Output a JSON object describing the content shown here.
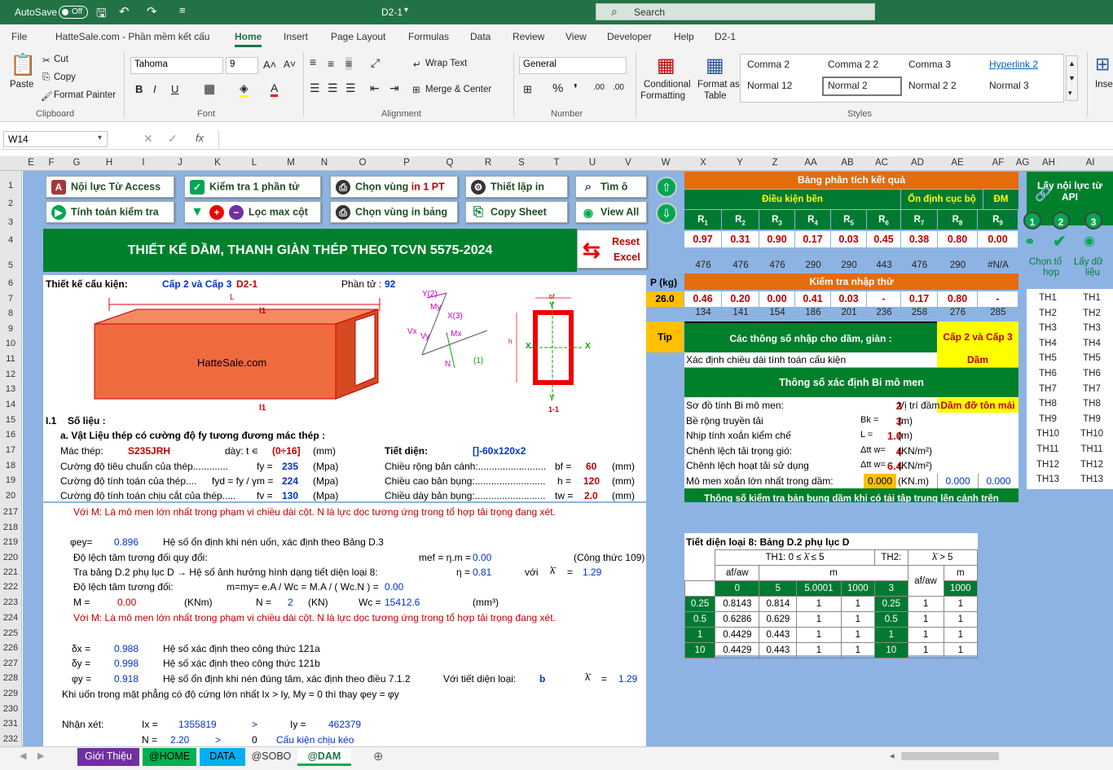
{
  "titlebar": {
    "autosave": "AutoSave",
    "toggle": "Off",
    "doc": "D2-1",
    "search": "Search"
  },
  "menu": [
    "File",
    "HatteSale.com - Phần mềm kết cấu",
    "Home",
    "Insert",
    "Page Layout",
    "Formulas",
    "Data",
    "Review",
    "View",
    "Developer",
    "Help",
    "D2-1"
  ],
  "ribbon": {
    "clipboard": {
      "paste": "Paste",
      "cut": "Cut",
      "copy": "Copy",
      "painter": "Format Painter",
      "label": "Clipboard"
    },
    "font": {
      "name": "Tahoma",
      "size": "9",
      "label": "Font"
    },
    "alignment": {
      "wrap": "Wrap Text",
      "merge": "Merge & Center",
      "label": "Alignment"
    },
    "number": {
      "format": "General",
      "label": "Number"
    },
    "styles": {
      "cond1": "Conditional",
      "cond2": "Formatting",
      "fmt1": "Format as",
      "fmt2": "Table",
      "cells": [
        "Comma 2",
        "Comma 2 2",
        "Comma 3",
        "Hyperlink 2",
        "Normal 12",
        "Normal 2",
        "Normal 2 2",
        "Normal 3"
      ],
      "label": "Styles"
    },
    "insert": "Inser"
  },
  "namebox": "W14",
  "columns": [
    [
      "E",
      38
    ],
    [
      "F",
      63
    ],
    [
      "G",
      94
    ],
    [
      "H",
      134
    ],
    [
      "I",
      176
    ],
    [
      "J",
      221
    ],
    [
      "K",
      267
    ],
    [
      "L",
      312
    ],
    [
      "M",
      357
    ],
    [
      "N",
      398
    ],
    [
      "O",
      445
    ],
    [
      "P",
      499
    ],
    [
      "Q",
      552
    ],
    [
      "R",
      599
    ],
    [
      "S",
      640
    ],
    [
      "T",
      683
    ],
    [
      "U",
      727
    ],
    [
      "V",
      771
    ],
    [
      "W",
      817
    ],
    [
      "X",
      863
    ],
    [
      "Y",
      908
    ],
    [
      "Z",
      951
    ],
    [
      "AA",
      995
    ],
    [
      "AB",
      1040
    ],
    [
      "AC",
      1082
    ],
    [
      "AD",
      1126
    ],
    [
      "AE",
      1175
    ],
    [
      "AF",
      1225
    ],
    [
      "AG",
      1255
    ],
    [
      "AH",
      1287
    ],
    [
      "AI",
      1338
    ]
  ],
  "rows": [
    [
      "1",
      228
    ],
    [
      "2",
      250
    ],
    [
      "3",
      273
    ],
    [
      "4",
      295
    ],
    [
      "5",
      326
    ],
    [
      "6",
      348
    ],
    [
      "7",
      367
    ],
    [
      "8",
      385
    ],
    [
      "9",
      404
    ],
    [
      "10",
      422
    ],
    [
      "11",
      441
    ],
    [
      "12",
      460
    ],
    [
      "13",
      478
    ],
    [
      "14",
      497
    ],
    [
      "15",
      516
    ],
    [
      "16",
      534
    ],
    [
      "17",
      553
    ],
    [
      "18",
      572
    ],
    [
      "19",
      590
    ],
    [
      "20",
      609
    ],
    [
      "217",
      629
    ],
    [
      "218",
      648
    ],
    [
      "219",
      666
    ],
    [
      "220",
      685
    ],
    [
      "221",
      703
    ],
    [
      "222",
      721
    ],
    [
      "223",
      740
    ],
    [
      "224",
      759
    ],
    [
      "225",
      778
    ],
    [
      "226",
      796
    ],
    [
      "227",
      815
    ],
    [
      "228",
      833
    ],
    [
      "229",
      852
    ],
    [
      "230",
      871
    ],
    [
      "231",
      889
    ],
    [
      "232",
      908
    ]
  ],
  "buttons": {
    "access": "Nội lực Từ Access",
    "check1": "Kiểm tra 1 phần tử",
    "sel1a": "Chọn vùng ",
    "sel1b": "in 1 PT",
    "setup": "Thiết lập in",
    "find": "Tìm ô",
    "calc": "Tính toán kiểm tra",
    "filter": "Lọc max cột",
    "selall": "Chọn vùng in bảng",
    "copysheet": "Copy Sheet",
    "viewall": "View All",
    "reset1": "Reset",
    "reset2": "Excel"
  },
  "title": "THIẾT KẾ DẦM, THANH GIÀN THÉP THEO TCVN 5575-2024",
  "design": {
    "label": "Thiết kế cấu kiện:",
    "grade": "Cấp 2 và Cấp 3",
    "code": "D2-1",
    "elem_label": "Phần tử :",
    "elem": "92",
    "L": "L",
    "l1": "l1",
    "l1b": "l1",
    "watermark": "HatteSale.com",
    "Y2": "Y(2)",
    "X3": "X(3)",
    "My": "My",
    "Mx": "Mx",
    "Vx": "Vx",
    "Vy": "Vy",
    "N": "N",
    "one": "(1)",
    "secX": "X",
    "secX2": "X",
    "secY": "Y",
    "secY2": "Y",
    "sec11": "1-1",
    "dimb": "bf",
    "dimh": "h"
  },
  "analysis": {
    "title": "Bảng phân tích kết quả",
    "bearing": "Điều kiện bền",
    "local": "Ổn định cục bộ",
    "dm": "ĐM",
    "R": [
      "R1",
      "R2",
      "R3",
      "R4",
      "R5",
      "R6",
      "R7",
      "R8",
      "R9"
    ],
    "vals": [
      "0.97",
      "0.31",
      "0.90",
      "0.17",
      "0.03",
      "0.45",
      "0.38",
      "0.80",
      "0.00"
    ],
    "row5": [
      "476",
      "476",
      "476",
      "290",
      "290",
      "443",
      "476",
      "290",
      "#N/A"
    ]
  },
  "pkg": {
    "label": "P (kg)",
    "value": "26.0"
  },
  "input_check": {
    "title": "Kiểm tra nhập thử",
    "vals": [
      "0.46",
      "0.20",
      "0.00",
      "0.41",
      "0.03",
      "-",
      "0.17",
      "0.80",
      "-"
    ],
    "row8": [
      "134",
      "141",
      "154",
      "186",
      "201",
      "236",
      "258",
      "276",
      "285"
    ]
  },
  "right": {
    "api1": "Lấy nội lực từ",
    "api2": "API",
    "n1": "1",
    "n2": "2",
    "n3": "3",
    "pick1": "Chọn tổ",
    "pick2": "hợp",
    "get1": "Lấy dữ",
    "get2": "liệu",
    "th": [
      "TH1",
      "TH2",
      "TH3",
      "TH4",
      "TH5",
      "TH6",
      "TH7",
      "TH8",
      "TH9",
      "TH10",
      "TH11",
      "TH12",
      "TH13"
    ]
  },
  "params": {
    "tip": "Tip",
    "header": "Các thông số nhập cho dầm, giàn :",
    "grade": "Cấp 2 và Cấp 3",
    "len_label": "Xác định chiều dài tính toán cấu kiện",
    "len_val": "Dầm",
    "bi_title": "Thông số xác định Bi mô men",
    "rows": [
      {
        "label": "Sơ đồ tính Bi mô men:",
        "sym": "",
        "val": "2",
        "unit": "Vị trí đầm"
      },
      {
        "label": "Bề rộng truyền tải",
        "sym": "Bk =",
        "val": "3",
        "unit": "(m)"
      },
      {
        "label": "Nhịp tính xoắn kiểm chế",
        "sym": "L =",
        "val": "1.0",
        "unit": "(m)"
      },
      {
        "label": "Chênh lệch tải trọng gió:",
        "sym": "Δtt w=",
        "val": "4",
        "unit": "(KN/m²)"
      },
      {
        "label": "Chênh lệch hoạt tải sử dụng",
        "sym": "Δtt w=",
        "val": "6.4",
        "unit": "(KN/m²)"
      },
      {
        "label": "Mô men xoắn lớn nhất trong dầm:",
        "sym": "",
        "val": "0.000",
        "unit": "(KN.m)"
      }
    ],
    "pos": "Dầm đỡ tôn mái",
    "m1": "0.000",
    "m2": "0.000",
    "bottom": "Thông số kiểm tra bản bụng dầm khi có tải tập trung lên cánh trên"
  },
  "data": {
    "sec": "I.1",
    "sec_label": "Số liệu :",
    "mat_title": "a. Vật Liệu thép có cường độ fy tương đương mác thép :",
    "steel_label": "Mác thép:",
    "steel": "S235JRH",
    "thick_label": "dày: t ∊",
    "thick": "(0÷16]",
    "thick_unit": "(mm)",
    "fy_label": "Cường độ tiêu chuẩn của thép.............",
    "fy_sym": "fy =",
    "fy": "235",
    "fy_unit": "(Mpa)",
    "fyd_label": "Cường độ tính toán của thép....",
    "fyd_sym": "fyd = fy / γm =",
    "fyd": "224",
    "fyd_unit": "(Mpa)",
    "fv_label": "Cường độ tính toán chịu cắt của thép.....",
    "fv_sym": "fv =",
    "fv": "130",
    "fv_unit": "(Mpa)",
    "sec_label2": "Tiết diện:",
    "section": "[]-60x120x2",
    "bf_label": "Chiều rộng bản cánh:.........................",
    "bf_sym": "bf =",
    "bf": "60",
    "bf_unit": "(mm)",
    "h_label": "Chiều cao bản bụng:..........................",
    "h_sym": "h =",
    "h": "120",
    "h_unit": "(mm)",
    "tw_label": "Chiều dày bản bụng:..........................",
    "tw_sym": "tw =",
    "tw": "2.0",
    "tw_unit": "(mm)"
  },
  "lower": {
    "note1": "Với M:  Là mô men lớn nhất trong phạm vi chiều dài cột. N là lực dọc tương ứng trong tổ hợp tải trọng đang xét.",
    "phi_ey_sym": "φey=",
    "phi_ey": "0.896",
    "phi_ey_desc": "Hệ số ổn định khi nén uốn, xác định theo Bảng D.3",
    "ecc_label": "Độ lệch tâm tương đối quy đổi:",
    "mef_sym": "mef = η.m =",
    "mef": "0.00",
    "formula": "(Công thức 109)",
    "table_label": "Tra bảng D.2 phụ lục D → Hệ số ảnh hưởng hình dạng tiết diện loại 8:",
    "eta_sym": "η =",
    "eta": "0.81",
    "with": "với",
    "lambda_sym": "λ̄",
    "eq": "=",
    "lambda": "1.29",
    "ecc2_label": "Độ lệch tâm tương đối:",
    "m_formula": "m=my= e.A / Wc = M.A / ( Wc.N ) =",
    "m_val": "0.00",
    "M_sym": "M =",
    "M": "0.00",
    "M_unit": "(KNm)",
    "N_sym": "N =",
    "N": "2",
    "N_unit": "(KN)",
    "Wc_sym": "Wc =",
    "Wc": "15412.6",
    "Wc_unit": "(mm³)",
    "note2": "Với M:  Là mô men lớn nhất trong phạm vi chiều dài cột. N là lực dọc tương ứng trong tổ hợp tải trọng đang xét.",
    "dx_sym": "δx =",
    "dx": "0.988",
    "dx_desc": "Hệ số xác định theo công thức 121a",
    "dy_sym": "δy =",
    "dy": "0.998",
    "dy_desc": "Hệ số xác định theo công thức 121b",
    "phiy_sym": "φy =",
    "phiy": "0.918",
    "phiy_desc": "Hệ số ổn định khi nén đúng tâm, xác định theo điều 7.1.2",
    "sec_type": "Với tiết diện loại:",
    "sec_type_val": "b",
    "lambda2_sym": "λ̄",
    "eq2": "=",
    "lambda2": "1.29",
    "bend_note": "Khi uốn trong mặt phẳng có độ cứng lớn nhất Ix > Iy, My = 0 thì thay  φey = φy",
    "remark": "Nhận xét:",
    "Ix_sym": "Ix =",
    "Ix": "1355819",
    "gt": ">",
    "Iy_sym": "Iy =",
    "Iy": "462379",
    "N2_sym": "N =",
    "N2": "2.20",
    "gt2": ">",
    "zero": "0",
    "tension": "Cấu kiện chịu kéo"
  },
  "d2": {
    "title": "Tiết diện loại 8: Bảng D.2 phụ lục D",
    "th1": "TH1: 0 ≤ λ̄ ≤ 5",
    "th2": "TH2:",
    "th2b": "λ̄ > 5",
    "afaw": "af/aw",
    "m": "m",
    "cols1": [
      "0",
      "5",
      "5.0001",
      "1000"
    ],
    "cols2": [
      "3",
      "1000"
    ],
    "rows": [
      [
        "0.25",
        "0.8143",
        "0.814",
        "1",
        "1",
        "0.25",
        "1",
        "1"
      ],
      [
        "0.5",
        "0.6286",
        "0.629",
        "1",
        "1",
        "0.5",
        "1",
        "1"
      ],
      [
        "1",
        "0.4429",
        "0.443",
        "1",
        "1",
        "1",
        "1",
        "1"
      ],
      [
        "10",
        "0.4429",
        "0.443",
        "1",
        "1",
        "10",
        "1",
        "1"
      ]
    ]
  },
  "tabs": [
    "Giới Thiệu",
    "@HOME",
    "DATA",
    "@SOBO",
    "@DAM"
  ],
  "colors": {
    "excel_green": "#217346",
    "sheet_blue": "#8db3e2",
    "header_green": "#007a33",
    "orange": "#e46c0a",
    "red": "#c00000"
  }
}
